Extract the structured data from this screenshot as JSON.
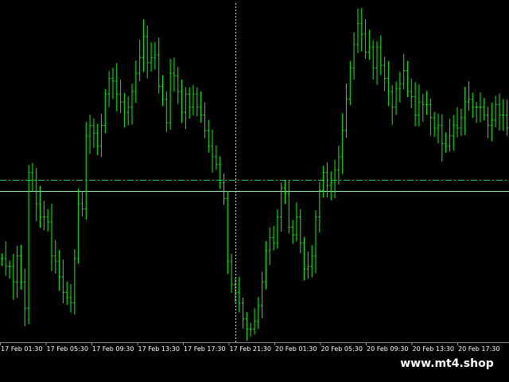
{
  "window": {
    "background": "#000000"
  },
  "chart_data": {
    "type": "line",
    "x": [
      "17 Feb 01:30",
      "17 Feb 05:30",
      "17 Feb 09:30",
      "17 Feb 13:30",
      "17 Feb 17:30",
      "17 Feb 21:30",
      "20 Feb 01:30",
      "20 Feb 05:30",
      "20 Feb 09:30",
      "20 Feb 13:30",
      "20 Feb 17:30"
    ],
    "series": [
      {
        "values": [
          0.29,
          0.26,
          0.26,
          0.2,
          0.3,
          0.2,
          0.1,
          0.62,
          0.59,
          0.5,
          0.45,
          0.45,
          0.43,
          0.3,
          0.28,
          0.22,
          0.16,
          0.14,
          0.12,
          0.29,
          0.5,
          0.48,
          0.76,
          0.8,
          0.77,
          0.72,
          0.8,
          0.92,
          0.98,
          0.97,
          0.92,
          0.89,
          0.85,
          0.87,
          0.93,
          1.0,
          1.06,
          1.14,
          1.04,
          1.06,
          1.07,
          0.95,
          0.9,
          0.81,
          1.0,
          0.99,
          0.93,
          0.85,
          0.92,
          0.87,
          0.92,
          0.87,
          0.84,
          0.78,
          0.72,
          0.68,
          0.65,
          0.58,
          0.52,
          0.28,
          0.19,
          0.16,
          0.12,
          0.06,
          0.02,
          0.02,
          0.05,
          0.11,
          0.2,
          0.32,
          0.37,
          0.35,
          0.45,
          0.56,
          0.54,
          0.41,
          0.38,
          0.45,
          0.35,
          0.25,
          0.26,
          0.3,
          0.45,
          0.55,
          0.62,
          0.57,
          0.58,
          0.63,
          0.68,
          0.78,
          0.9,
          1.02,
          1.11,
          1.19,
          1.15,
          1.08,
          1.1,
          1.02,
          1.1,
          1.03,
          0.98,
          0.93,
          0.87,
          0.94,
          0.96,
          1.01,
          0.93,
          0.91,
          0.84,
          0.89,
          0.88,
          0.88,
          0.83,
          0.79,
          0.8,
          0.73,
          0.72,
          0.76,
          0.8,
          0.79,
          0.83,
          0.89,
          0.9,
          0.87,
          0.87,
          0.87,
          0.84,
          0.8,
          0.82,
          0.88,
          0.84,
          0.84,
          0.79
        ]
      }
    ],
    "current_price_level": 0.55,
    "guide_lines": [
      {
        "style": "dash-dot",
        "value": 0.59,
        "color": "#22c55e"
      },
      {
        "style": "solid",
        "value": 0.55,
        "color": "#a7f3b8"
      }
    ],
    "crosshair_x_index": 61,
    "colors": {
      "bar": "#00ff00",
      "grid": "#000000",
      "axis": "#8c8c8c",
      "text": "#ffffff"
    }
  },
  "watermark_text": "www.mt4.shop"
}
